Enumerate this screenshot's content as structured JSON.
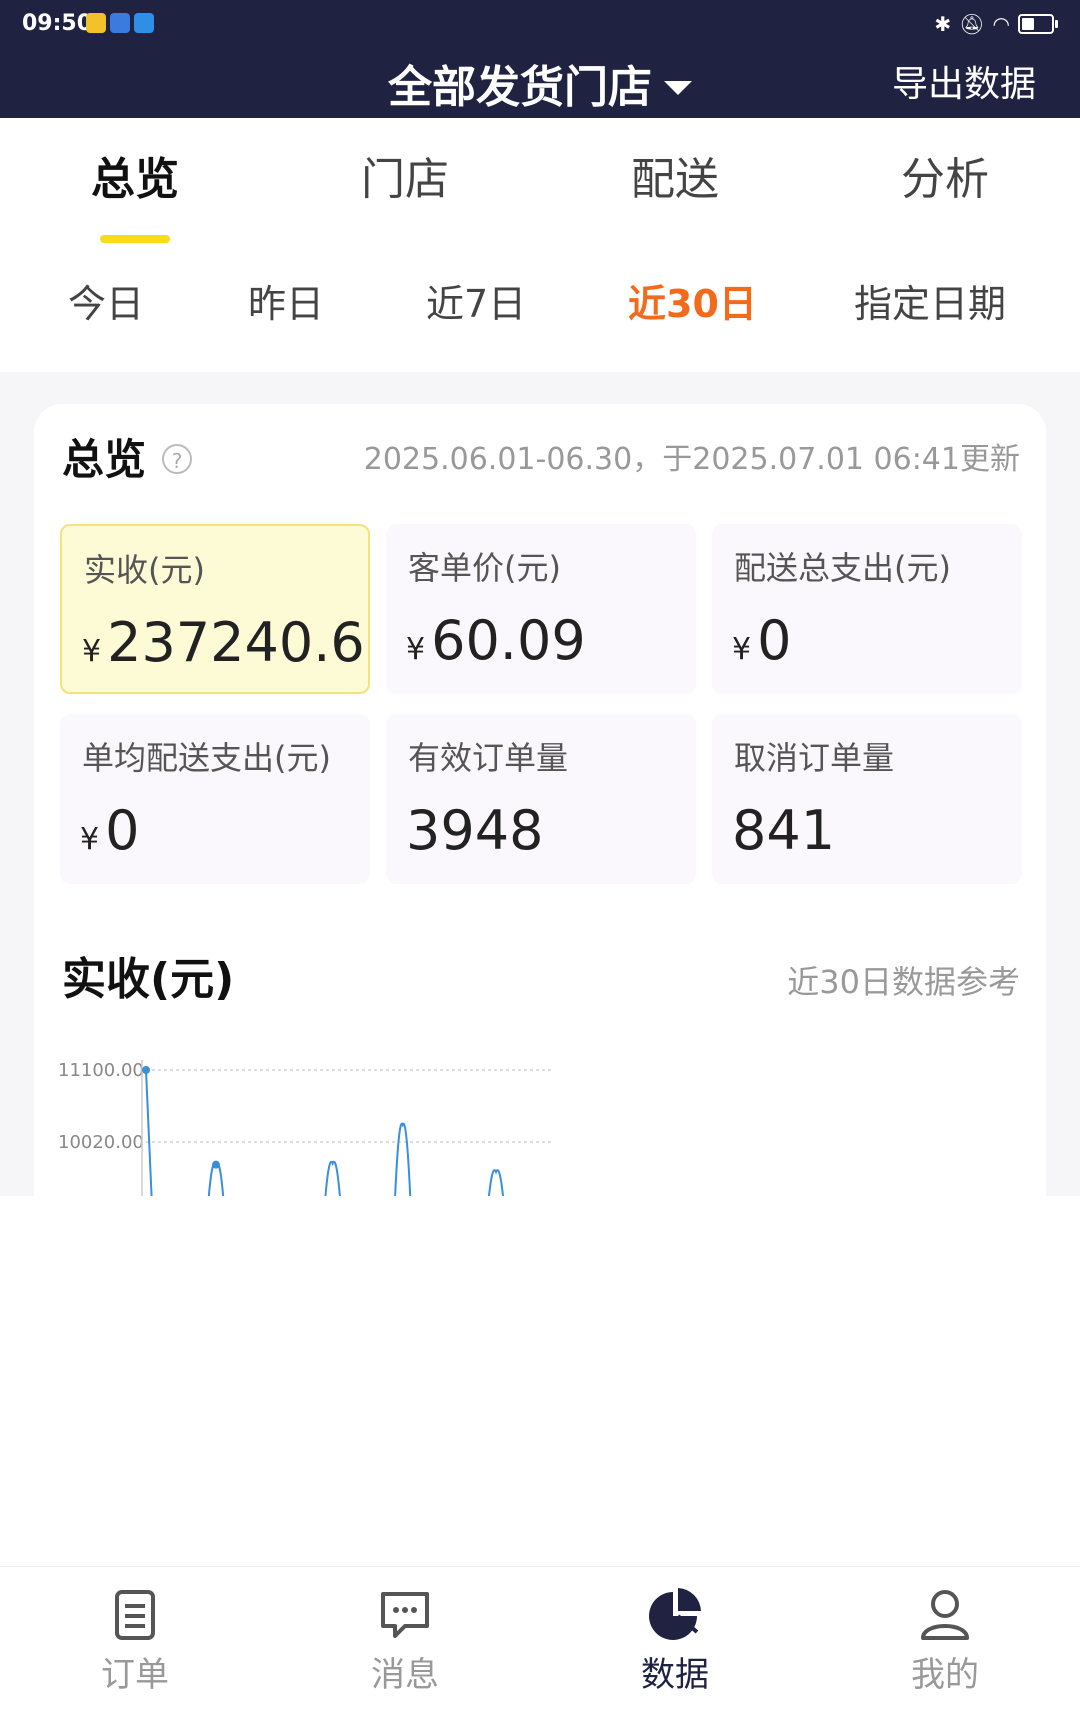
{
  "status_bar": {
    "time": "09:50"
  },
  "header": {
    "store_selector": "全部发货门店",
    "export_label": "导出数据"
  },
  "main_tabs": [
    {
      "label": "总览",
      "active": true
    },
    {
      "label": "门店",
      "active": false
    },
    {
      "label": "配送",
      "active": false
    },
    {
      "label": "分析",
      "active": false
    }
  ],
  "date_filters": [
    {
      "label": "今日",
      "active": false
    },
    {
      "label": "昨日",
      "active": false
    },
    {
      "label": "近7日",
      "active": false
    },
    {
      "label": "近30日",
      "active": true
    },
    {
      "label": "指定日期",
      "active": false
    }
  ],
  "overview": {
    "title": "总览",
    "help_glyph": "?",
    "range_text": "2025.06.01-06.30，于2025.07.01 06:41更新",
    "currency_symbol": "¥",
    "metrics": [
      {
        "label": "实收(元)",
        "value": "237240.6",
        "currency": true,
        "highlighted": true
      },
      {
        "label": "客单价(元)",
        "value": "60.09",
        "currency": true,
        "highlighted": false
      },
      {
        "label": "配送总支出(元)",
        "value": "0",
        "currency": true,
        "highlighted": false
      },
      {
        "label": "单均配送支出(元)",
        "value": "0",
        "currency": true,
        "highlighted": false
      },
      {
        "label": "有效订单量",
        "value": "3948",
        "currency": false,
        "highlighted": false
      },
      {
        "label": "取消订单量",
        "value": "841",
        "currency": false,
        "highlighted": false
      }
    ]
  },
  "chart_section": {
    "title": "实收(元)",
    "note": "近30日数据参考"
  },
  "chart_data": {
    "type": "line",
    "title": "实收(元)",
    "y_ticks": [
      "11100.00",
      "10020.00"
    ],
    "ylim_visible": [
      9500,
      11300
    ],
    "series_color": "#3a8fd9",
    "points_visible": [
      {
        "x": 0,
        "y": 11100
      },
      {
        "x": 3,
        "y": 9680
      },
      {
        "x": 8,
        "y": 9700
      },
      {
        "x": 11,
        "y": 10280
      },
      {
        "x": 15,
        "y": 9570
      }
    ]
  },
  "bottom_nav": [
    {
      "label": "订单",
      "icon": "order-list-icon",
      "active": false
    },
    {
      "label": "消息",
      "icon": "message-icon",
      "active": false
    },
    {
      "label": "数据",
      "icon": "pie-chart-icon",
      "active": true
    },
    {
      "label": "我的",
      "icon": "user-icon",
      "active": false
    }
  ],
  "colors": {
    "header_bg": "#1f2240",
    "accent_orange": "#f26b1d",
    "tab_indicator": "#f8dc19",
    "chart_line": "#3a8fd9"
  }
}
